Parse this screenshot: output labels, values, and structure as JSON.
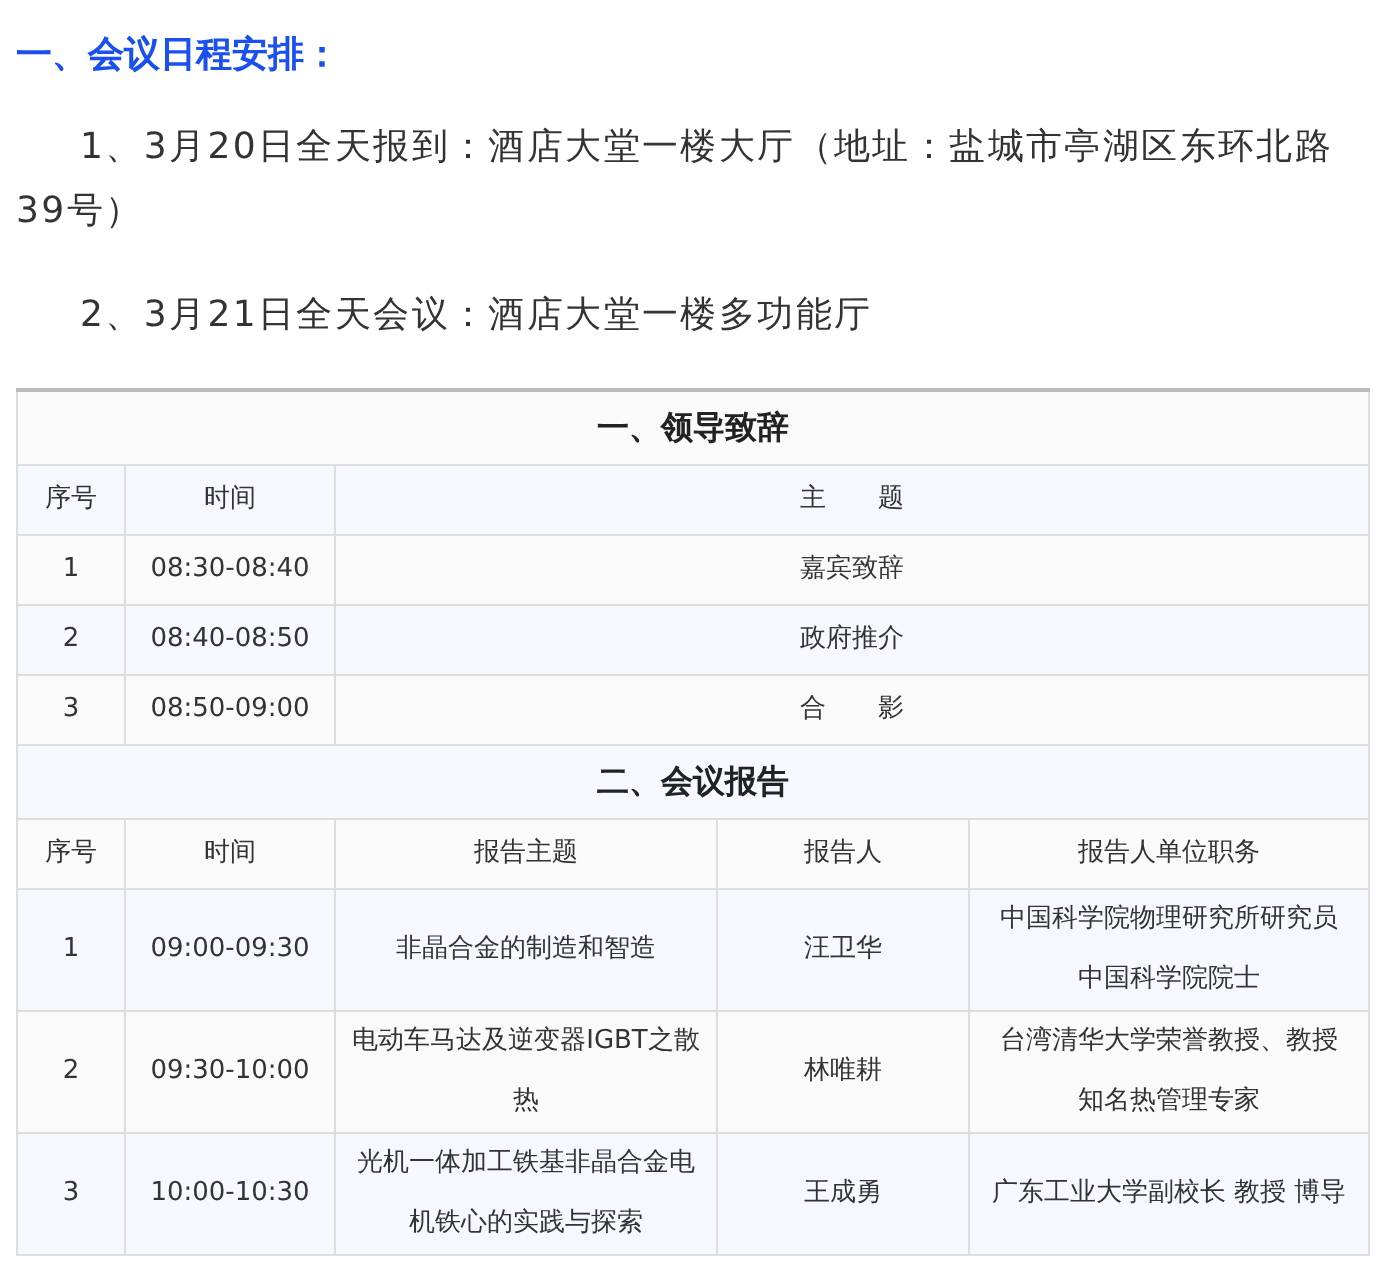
{
  "heading": "一、会议日程安排：",
  "paragraphs": [
    "1、3月20日全天报到：酒店大堂一楼大厅（地址：盐城市亭湖区东环北路39号）",
    "2、3月21日全天会议：酒店大堂一楼多功能厅"
  ],
  "sections": [
    {
      "title": "一、领导致辞",
      "columns": [
        "序号",
        "时间",
        "主　　题"
      ],
      "rows": [
        [
          "1",
          "08:30-08:40",
          "嘉宾致辞"
        ],
        [
          "2",
          "08:40-08:50",
          "政府推介"
        ],
        [
          "3",
          "08:50-09:00",
          "合　　影"
        ]
      ]
    },
    {
      "title": "二、会议报告",
      "columns": [
        "序号",
        "时间",
        "报告主题",
        "报告人",
        "报告人单位职务"
      ],
      "rows": [
        [
          "1",
          "09:00-09:30",
          "非晶合金的制造和智造",
          "汪卫华",
          [
            "中国科学院物理研究所研究员",
            "中国科学院院士"
          ]
        ],
        [
          "2",
          "09:30-10:00",
          "电动车马达及逆变器IGBT之散热",
          "林唯耕",
          [
            "台湾清华大学荣誉教授、教授",
            "知名热管理专家"
          ]
        ],
        [
          "3",
          "10:00-10:30",
          "光机一体加工铁基非晶合金电机铁心的实践与探索",
          "王成勇",
          [
            "广东工业大学副校长 教授 博导"
          ]
        ]
      ]
    }
  ]
}
